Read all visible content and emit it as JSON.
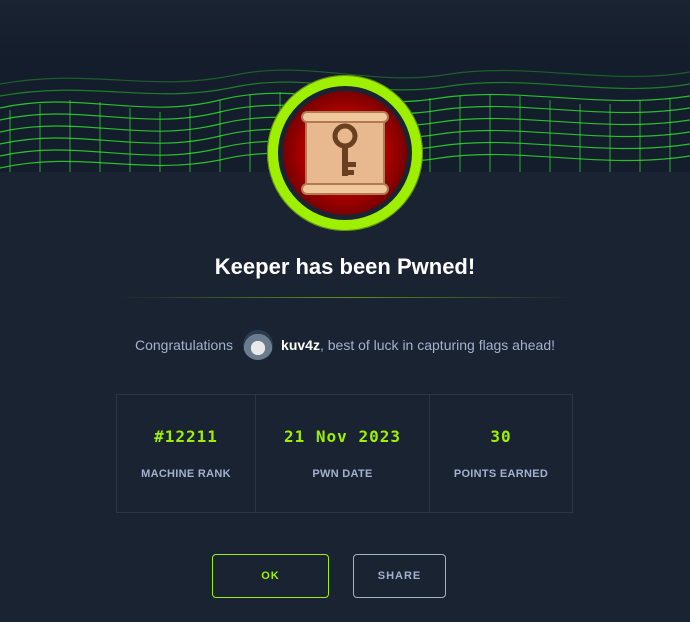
{
  "banner": {
    "image": "green-wireframe-wave"
  },
  "badge": {
    "icon": "scroll-key-icon"
  },
  "title": "Keeper has been Pwned!",
  "congrats": {
    "prefix": "Congratulations",
    "username": "kuv4z",
    "suffix": ", best of luck in capturing flags ahead!"
  },
  "stats": [
    {
      "value": "#12211",
      "label": "MACHINE RANK"
    },
    {
      "value": "21 Nov 2023",
      "label": "PWN DATE"
    },
    {
      "value": "30",
      "label": "POINTS EARNED"
    }
  ],
  "buttons": {
    "ok": "OK",
    "share": "SHARE"
  },
  "colors": {
    "accent": "#9fef00",
    "background": "#1a2332",
    "muted": "#a4b1cd"
  }
}
